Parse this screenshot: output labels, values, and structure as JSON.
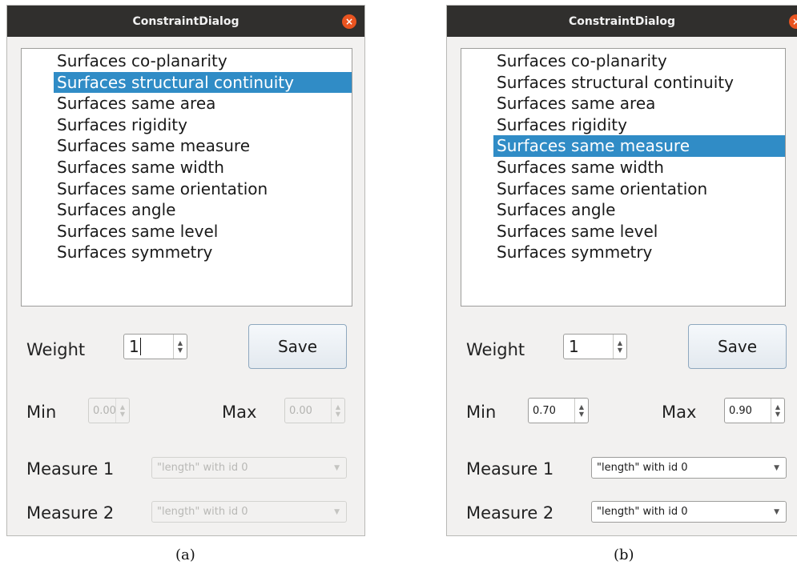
{
  "dialog_a": {
    "title": "ConstraintDialog",
    "close_glyph": "×",
    "list_items": [
      "Surfaces co-planarity",
      "Surfaces structural continuity",
      "Surfaces same area",
      "Surfaces rigidity",
      "Surfaces same measure",
      "Surfaces same width",
      "Surfaces same orientation",
      "Surfaces angle",
      "Surfaces same level",
      "Surfaces symmetry"
    ],
    "selected_index": 1,
    "weight_label": "Weight",
    "weight_value": "1",
    "save_label": "Save",
    "min_label": "Min",
    "min_value": "0.00",
    "max_label": "Max",
    "max_value": "0.00",
    "measure1_label": "Measure 1",
    "measure1_value": "\"length\" with id 0",
    "measure2_label": "Measure 2",
    "measure2_value": "\"length\" with id 0",
    "caption": "(a)"
  },
  "dialog_b": {
    "title": "ConstraintDialog",
    "close_glyph": "×",
    "list_items": [
      "Surfaces co-planarity",
      "Surfaces structural continuity",
      "Surfaces same area",
      "Surfaces rigidity",
      "Surfaces same measure",
      "Surfaces same width",
      "Surfaces same orientation",
      "Surfaces angle",
      "Surfaces same level",
      "Surfaces symmetry"
    ],
    "selected_index": 4,
    "weight_label": "Weight",
    "weight_value": "1",
    "save_label": "Save",
    "min_label": "Min",
    "min_value": "0.70",
    "max_label": "Max",
    "max_value": "0.90",
    "measure1_label": "Measure 1",
    "measure1_value": "\"length\" with id 0",
    "measure2_label": "Measure 2",
    "measure2_value": "\"length\" with id 0",
    "caption": "(b)"
  },
  "colors": {
    "titlebar": "#302f2d",
    "close": "#e95420",
    "selection": "#308cc6",
    "dialog_bg": "#f2f1f0"
  },
  "icons": {
    "close": "close-icon",
    "spin_up": "spin-up-icon",
    "spin_down": "spin-down-icon",
    "dropdown": "chevron-down-icon"
  }
}
